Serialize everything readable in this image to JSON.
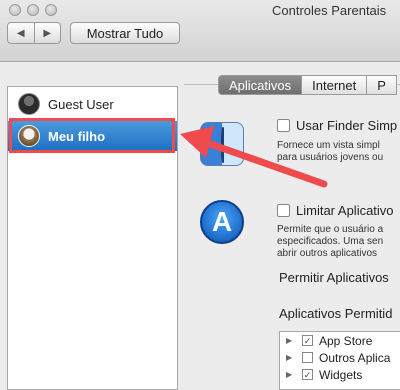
{
  "window": {
    "title": "Controles Parentais"
  },
  "toolbar": {
    "back_glyph": "◀",
    "forward_glyph": "▶",
    "show_all_label": "Mostrar Tudo"
  },
  "sidebar": {
    "users": [
      {
        "name": "Guest User",
        "selected": false
      },
      {
        "name": "Meu filho",
        "selected": true
      }
    ]
  },
  "tabs": [
    {
      "label": "Aplicativos",
      "active": true
    },
    {
      "label": "Internet",
      "active": false
    },
    {
      "label": "P",
      "active": false
    }
  ],
  "finder_section": {
    "checkbox_label": "Usar Finder Simp",
    "description_lines": [
      "Fornece um vista simpl",
      "para usuários jovens ou"
    ]
  },
  "apps_section": {
    "checkbox_label": "Limitar Aplicativo",
    "description_lines": [
      "Permite que o usuário a",
      "especificados. Uma sen",
      "abrir outros aplicativos"
    ],
    "allow_label": "Permitir Aplicativos",
    "allowed_label": "Aplicativos Permitid",
    "list": [
      {
        "label": "App Store",
        "checked": true
      },
      {
        "label": "Outros Aplica",
        "checked": false
      },
      {
        "label": "Widgets",
        "checked": true
      }
    ]
  },
  "annotation": {
    "color": "#ef4b4d"
  }
}
